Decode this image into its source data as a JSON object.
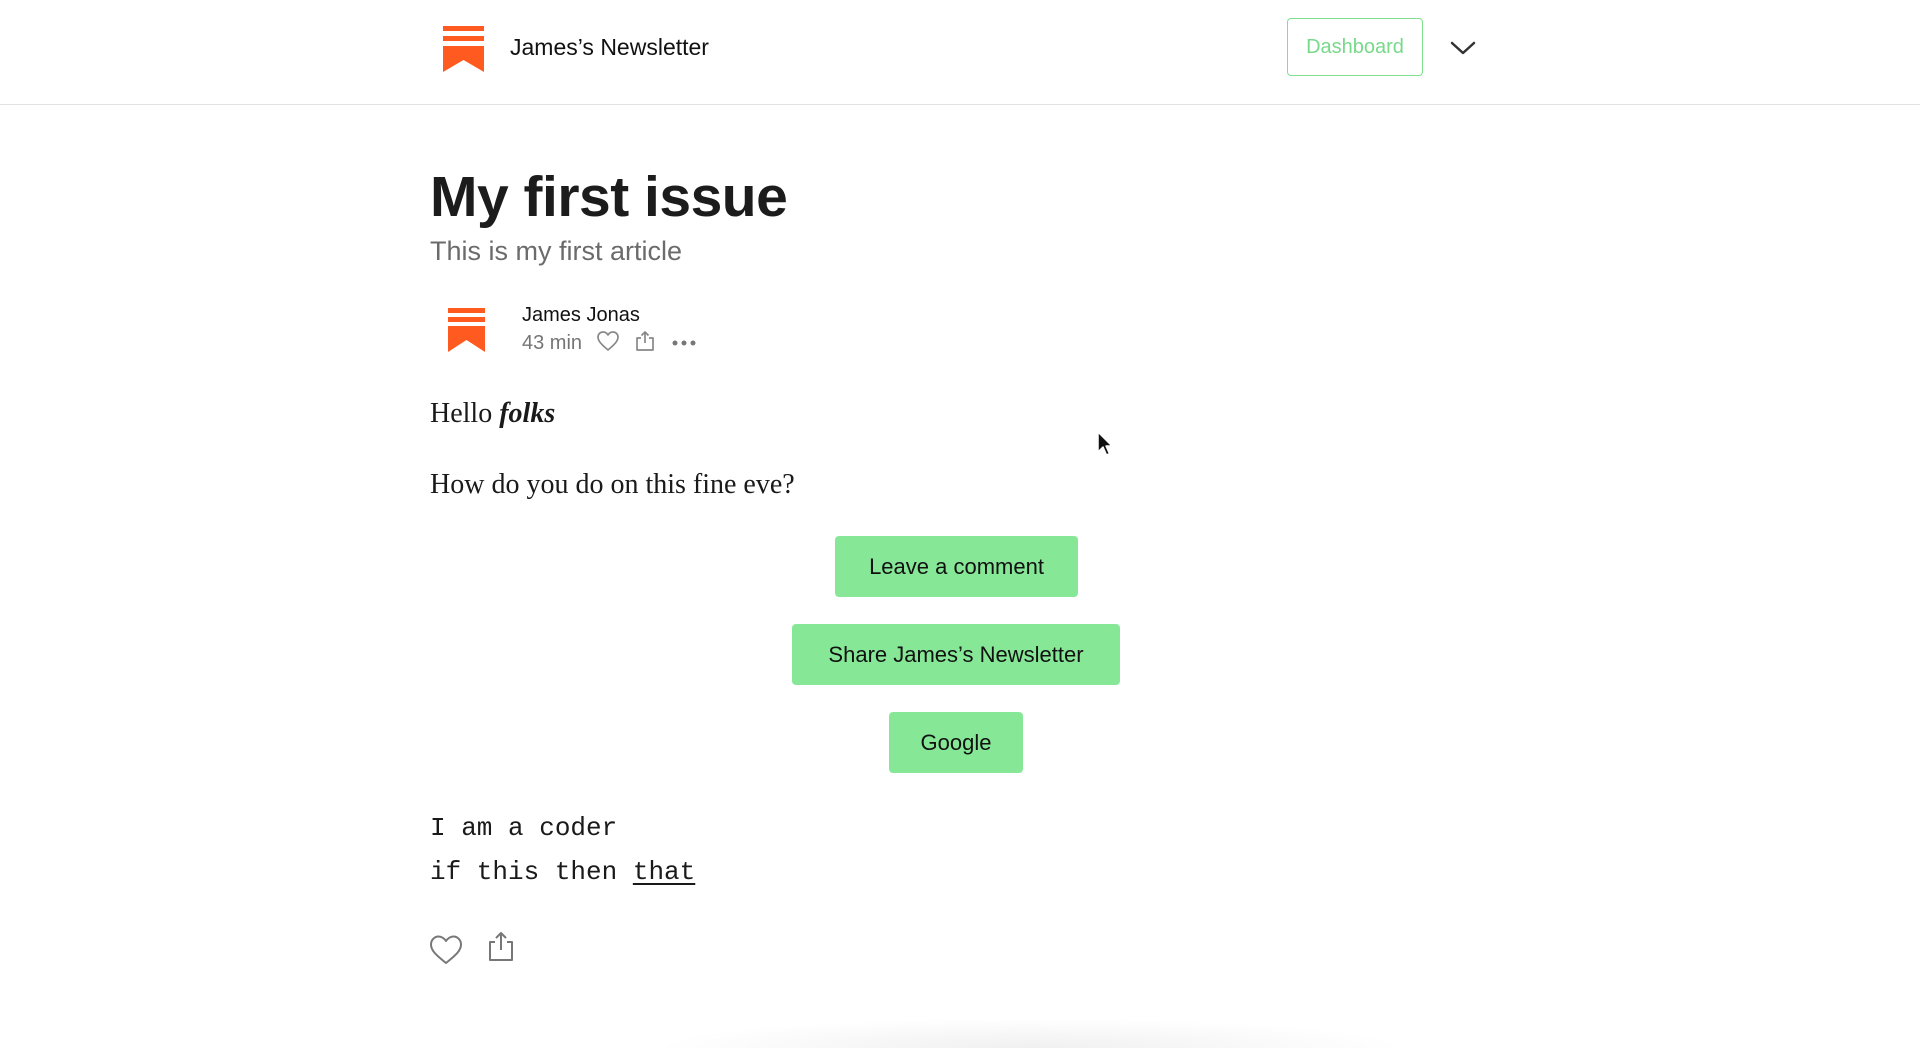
{
  "header": {
    "publication_name": "James’s Newsletter",
    "dashboard_label": "Dashboard",
    "brand_color": "#ff5a1f",
    "accent_color": "#7fe08e"
  },
  "article": {
    "title": "My first issue",
    "subtitle": "This is my first article",
    "author": "James Jonas",
    "read_time": "43 min",
    "paragraphs": {
      "greeting_prefix": "Hello",
      "greeting_emphasis": "folks",
      "question": "How do you do on this fine eve?"
    },
    "buttons": {
      "comment": "Leave a comment",
      "share": "Share James’s Newsletter",
      "google": "Google"
    },
    "code": {
      "line1": "I am a coder",
      "line2_prefix": "if this then",
      "line2_link": "that"
    }
  },
  "icons": [
    "substack-logo",
    "chevron-down-icon",
    "heart-icon",
    "share-icon",
    "more-icon"
  ]
}
